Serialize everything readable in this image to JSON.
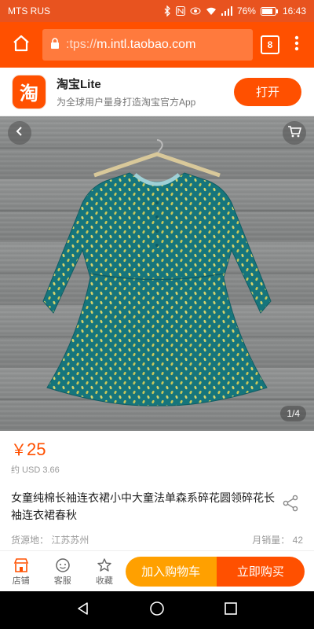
{
  "status_bar": {
    "carrier": "MTS RUS",
    "battery": "76%",
    "time": "16:43"
  },
  "browser": {
    "url_prefix": ":tps://",
    "url_host": "m.intl.taobao.com",
    "tab_count": "8"
  },
  "app_banner": {
    "logo_glyph": "淘",
    "name": "淘宝Lite",
    "description": "为全球用户量身打造淘宝官方App",
    "open_label": "打开"
  },
  "gallery": {
    "counter": "1/4"
  },
  "product": {
    "currency": "￥",
    "price": "25",
    "usd": "约 USD 3.66",
    "title": "女童纯棉长袖连衣裙小中大童法单森系碎花圆领碎花长袖连衣裙春秋",
    "origin_label": "货源地：",
    "origin": "江苏苏州",
    "monthly_sales_label": "月销量：",
    "monthly_sales": "42"
  },
  "action_bar": {
    "shop_label": "店铺",
    "service_label": "客服",
    "favorite_label": "收藏",
    "add_to_cart_label": "加入购物车",
    "buy_now_label": "立即购买"
  },
  "colors": {
    "brand_orange": "#ff5000",
    "cart_orange": "#ffa000",
    "dress_teal": "#1a7f86"
  }
}
